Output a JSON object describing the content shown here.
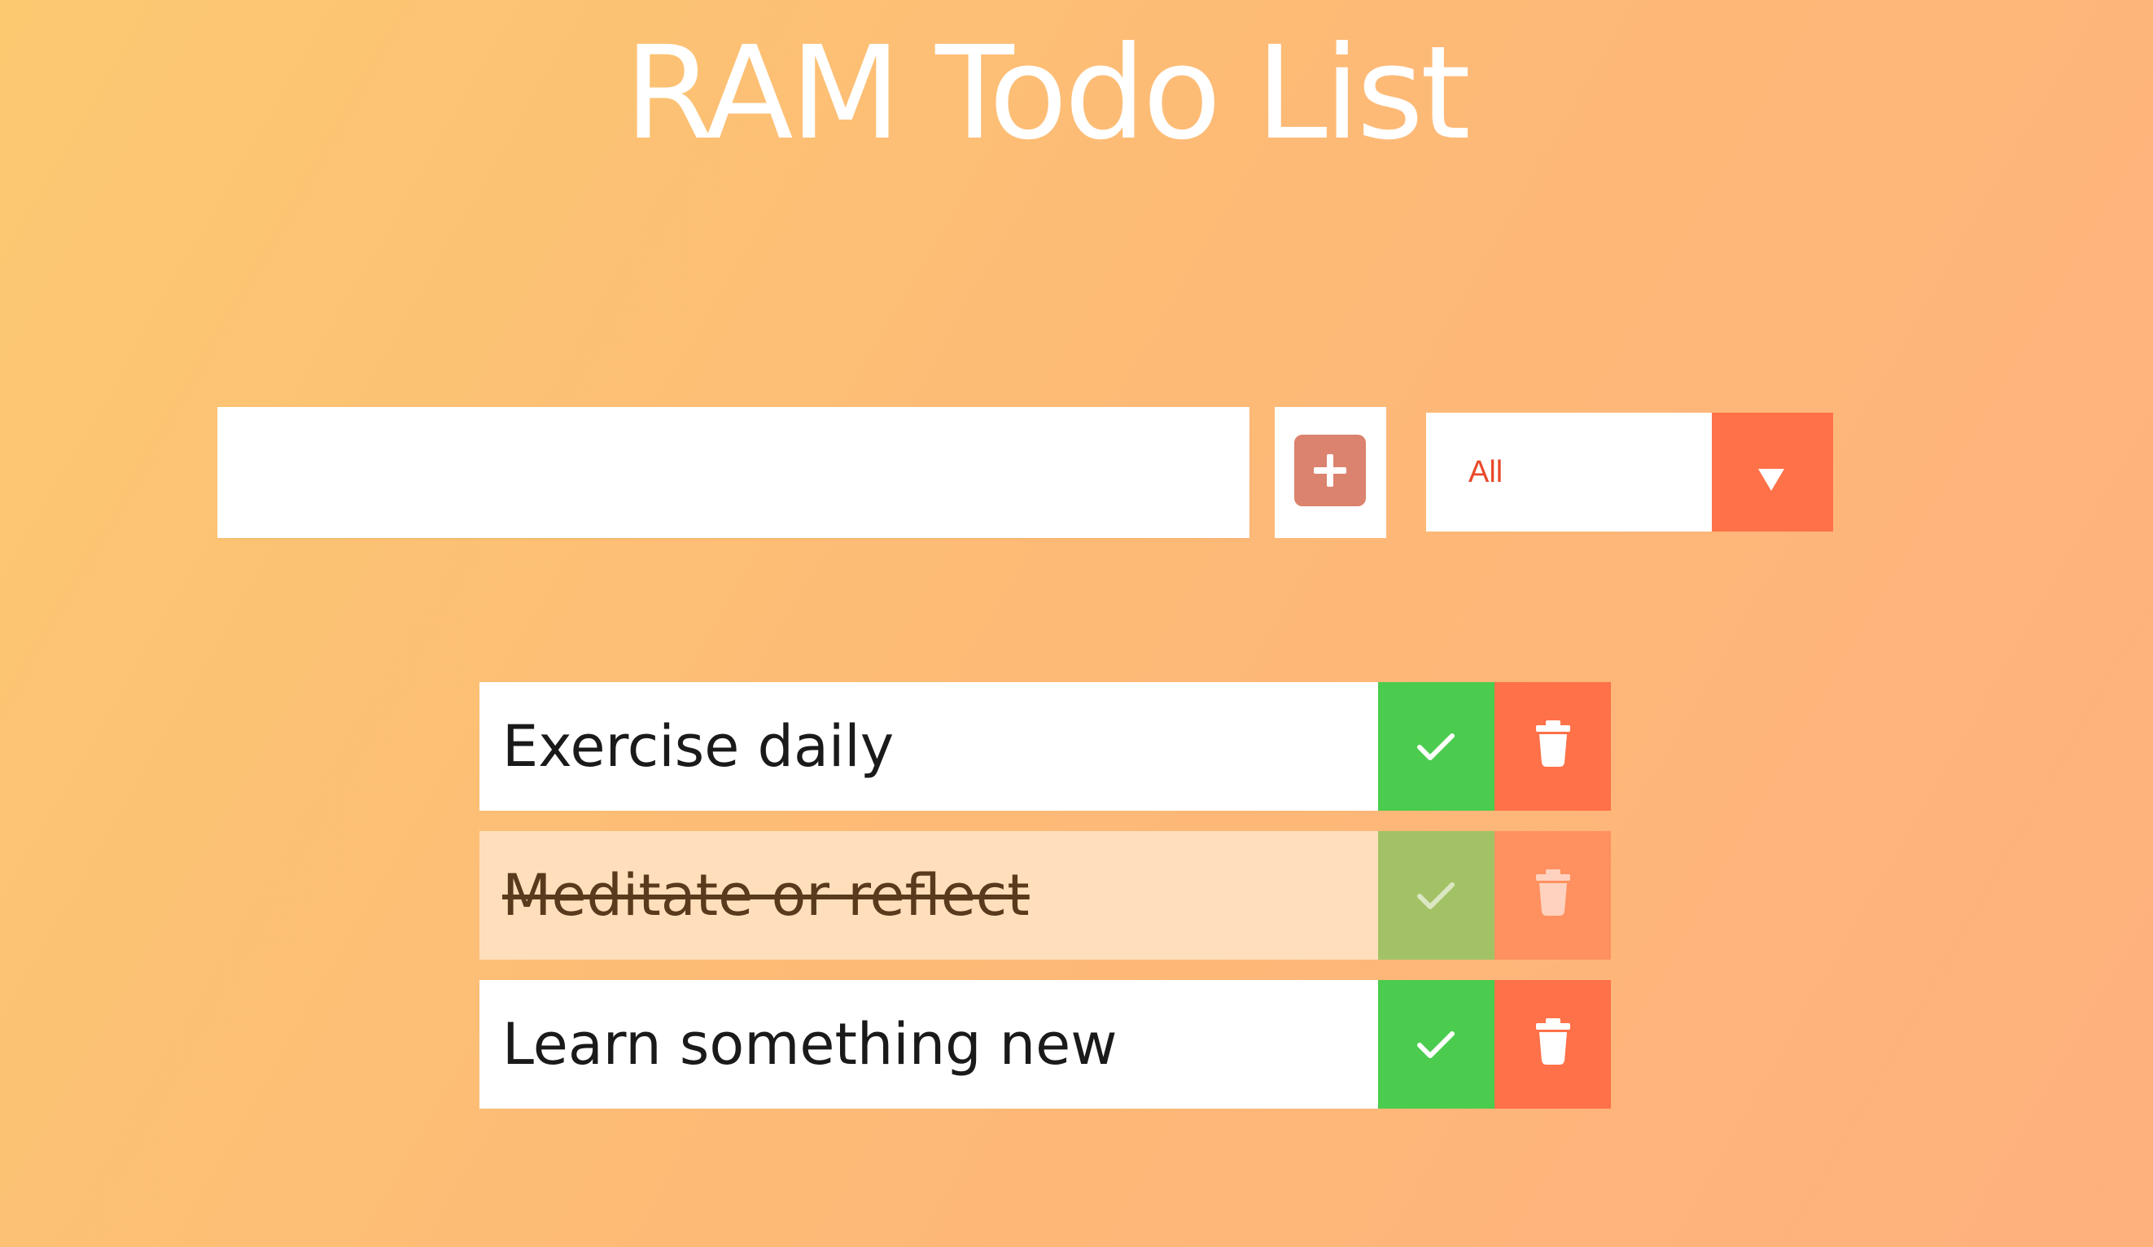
{
  "app": {
    "title": "RAM Todo List"
  },
  "form": {
    "input_value": "",
    "input_placeholder": "",
    "add_icon": "plus-icon",
    "add_button_color": "#db836e"
  },
  "filter": {
    "selected": "All",
    "arrow_icon": "caret-down-icon",
    "accent_color": "#ff7148"
  },
  "todos": [
    {
      "text": "Exercise daily",
      "completed": false
    },
    {
      "text": "Meditate or reflect",
      "completed": true
    },
    {
      "text": "Learn something new",
      "completed": false
    }
  ],
  "icons": {
    "complete": "check-icon",
    "delete": "trash-icon"
  },
  "colors": {
    "background_start": "#fcc971",
    "background_end": "#feb07d",
    "complete_button": "#4bcc4e",
    "delete_button": "#ff7148",
    "completed_item_background": "#ffdfbb"
  }
}
